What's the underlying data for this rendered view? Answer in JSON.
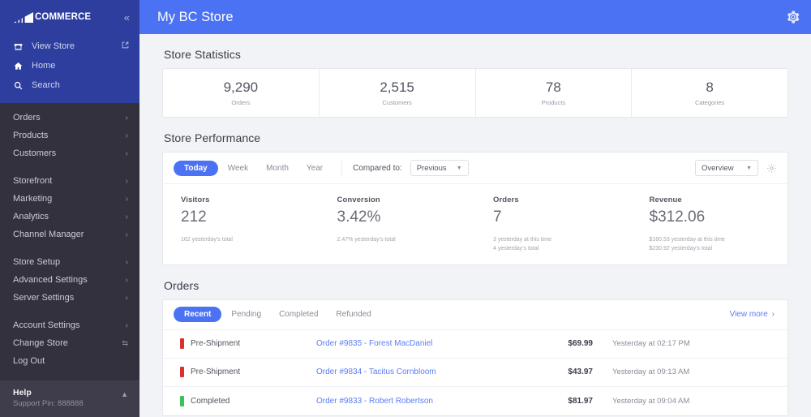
{
  "sidebar": {
    "brand": {
      "text": "COMMERCE",
      "logo_icon": "bigcommerce-logo-icon"
    },
    "collapse_icon": "chevron-double-left-icon",
    "quick_links": [
      {
        "label": "View Store",
        "icon": "store-icon",
        "trailing_icon": "external-link-icon"
      },
      {
        "label": "Home",
        "icon": "home-icon"
      },
      {
        "label": "Search",
        "icon": "search-icon"
      }
    ],
    "groups": [
      {
        "items": [
          {
            "label": "Orders",
            "trailing": "chevron-right-icon"
          },
          {
            "label": "Products",
            "trailing": "chevron-right-icon"
          },
          {
            "label": "Customers",
            "trailing": "chevron-right-icon"
          }
        ]
      },
      {
        "items": [
          {
            "label": "Storefront",
            "trailing": "chevron-right-icon"
          },
          {
            "label": "Marketing",
            "trailing": "chevron-right-icon"
          },
          {
            "label": "Analytics",
            "trailing": "chevron-right-icon"
          },
          {
            "label": "Channel Manager",
            "trailing": "chevron-right-icon"
          }
        ]
      },
      {
        "items": [
          {
            "label": "Store Setup",
            "trailing": "chevron-right-icon"
          },
          {
            "label": "Advanced Settings",
            "trailing": "chevron-right-icon"
          },
          {
            "label": "Server Settings",
            "trailing": "chevron-right-icon"
          }
        ]
      },
      {
        "items": [
          {
            "label": "Account Settings",
            "trailing": "chevron-right-icon"
          },
          {
            "label": "Change Store",
            "trailing": "swap-icon"
          },
          {
            "label": "Log Out",
            "trailing": ""
          }
        ]
      }
    ],
    "help": {
      "title": "Help",
      "support_pin": "Support Pin: 888888",
      "caret_icon": "chevron-up-icon"
    }
  },
  "topbar": {
    "title": "My BC Store",
    "settings_icon": "gear-icon"
  },
  "store_statistics": {
    "title": "Store Statistics",
    "stats": [
      {
        "value": "9,290",
        "label": "Orders"
      },
      {
        "value": "2,515",
        "label": "Customers"
      },
      {
        "value": "78",
        "label": "Products"
      },
      {
        "value": "8",
        "label": "Categories"
      }
    ]
  },
  "store_performance": {
    "title": "Store Performance",
    "range_tabs": [
      {
        "label": "Today",
        "active": true
      },
      {
        "label": "Week",
        "active": false
      },
      {
        "label": "Month",
        "active": false
      },
      {
        "label": "Year",
        "active": false
      }
    ],
    "compared_to_label": "Compared to:",
    "compared_to_value": "Previous",
    "view_select_value": "Overview",
    "settings_icon": "gear-icon",
    "metrics": [
      {
        "key": "Visitors",
        "value": "212",
        "subs": [
          "162 yesterday's total"
        ]
      },
      {
        "key": "Conversion",
        "value": "3.42%",
        "subs": [
          "2.47% yesterday's total"
        ]
      },
      {
        "key": "Orders",
        "value": "7",
        "subs": [
          "3 yesterday at this time",
          "4 yesterday's total"
        ]
      },
      {
        "key": "Revenue",
        "value": "$312.06",
        "subs": [
          "$160.53 yesterday at this time",
          "$230.92 yesterday's total"
        ]
      }
    ]
  },
  "orders": {
    "title": "Orders",
    "tabs": [
      {
        "label": "Recent",
        "active": true
      },
      {
        "label": "Pending",
        "active": false
      },
      {
        "label": "Completed",
        "active": false
      },
      {
        "label": "Refunded",
        "active": false
      }
    ],
    "view_more": "View more",
    "view_more_icon": "chevron-right-icon",
    "rows": [
      {
        "status": "Pre-Shipment",
        "status_color": "#d9322e",
        "link": "Order #9835 - Forest MacDaniel",
        "amount": "$69.99",
        "time": "Yesterday at 02:17 PM"
      },
      {
        "status": "Pre-Shipment",
        "status_color": "#d9322e",
        "link": "Order #9834 - Tacitus Cornbloom",
        "amount": "$43.97",
        "time": "Yesterday at 09:13 AM"
      },
      {
        "status": "Completed",
        "status_color": "#3ac15a",
        "link": "Order #9833 - Robert Robertson",
        "amount": "$81.97",
        "time": "Yesterday at 09:04 AM"
      }
    ]
  },
  "colors": {
    "brand_blue": "#4b72f3",
    "sidebar_top": "#2e3e9e",
    "sidebar_dark": "#34313f",
    "link_blue": "#5b7df5"
  }
}
